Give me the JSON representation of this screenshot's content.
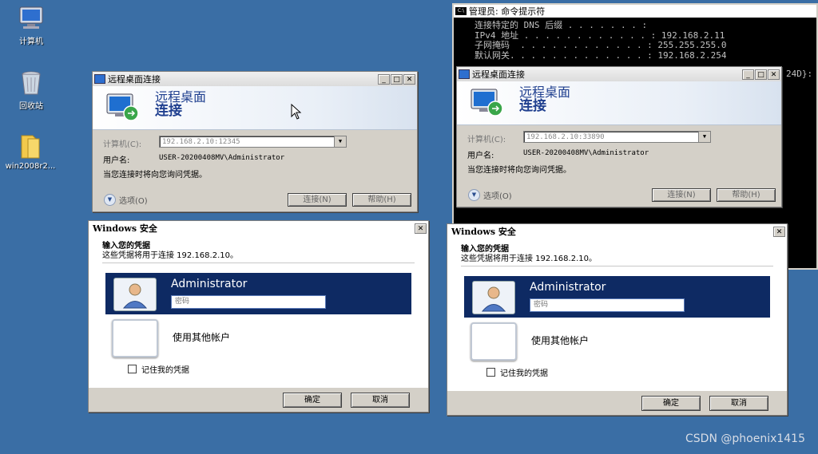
{
  "desktop": {
    "icons": [
      {
        "label": "计算机",
        "icon": "computer-icon"
      },
      {
        "label": "回收站",
        "icon": "recycle-bin-icon"
      },
      {
        "label": "win2008r2...",
        "icon": "folder-icon"
      }
    ]
  },
  "cmd": {
    "title": "管理员: 命令提示符",
    "lines": [
      "连接特定的 DNS 后缀 . . . . . . . :",
      "IPv4 地址 . . . . . . . . . . . . : 192.168.2.11",
      "子网掩码  . . . . . . . . . . . . : 255.255.255.0",
      "默认网关. . . . . . . . . . . . . : 192.168.2.254"
    ],
    "trail_text": "24D}:"
  },
  "rdp_left": {
    "title": "远程桌面连接",
    "heading_line1": "远程桌面",
    "heading_line2": "连接",
    "computer_label": "计算机(C):",
    "computer_value": "192.168.2.10:12345",
    "user_label": "用户名:",
    "user_value": "USER-20200408MV\\Administrator",
    "note": "当您连接时将向您询问凭据。",
    "options_label": "选项(O)",
    "connect_label": "连接(N)",
    "help_label": "帮助(H)"
  },
  "rdp_right": {
    "title": "远程桌面连接",
    "heading_line1": "远程桌面",
    "heading_line2": "连接",
    "computer_label": "计算机(C):",
    "computer_value": "192.168.2.10:33890",
    "user_label": "用户名:",
    "user_value": "USER-20200408MV\\Administrator",
    "note": "当您连接时将向您询问凭据。",
    "options_label": "选项(O)",
    "connect_label": "连接(N)",
    "help_label": "帮助(H)"
  },
  "sec_left": {
    "title": "Windows 安全",
    "heading": "输入您的凭据",
    "subheading": "这些凭据将用于连接 192.168.2.10。",
    "user_name": "Administrator",
    "password_placeholder": "密码",
    "other_account": "使用其他帐户",
    "remember": "记住我的凭据",
    "ok": "确定",
    "cancel": "取消"
  },
  "sec_right": {
    "title": "Windows 安全",
    "heading": "输入您的凭据",
    "subheading": "这些凭据将用于连接 192.168.2.10。",
    "user_name": "Administrator",
    "password_placeholder": "密码",
    "other_account": "使用其他帐户",
    "remember": "记住我的凭据",
    "ok": "确定",
    "cancel": "取消"
  },
  "watermark": "CSDN @phoenix1415",
  "colors": {
    "desktop": "#3a6ea5",
    "tile": "#0e2a63",
    "rdp_heading": "#1f3f8f"
  }
}
